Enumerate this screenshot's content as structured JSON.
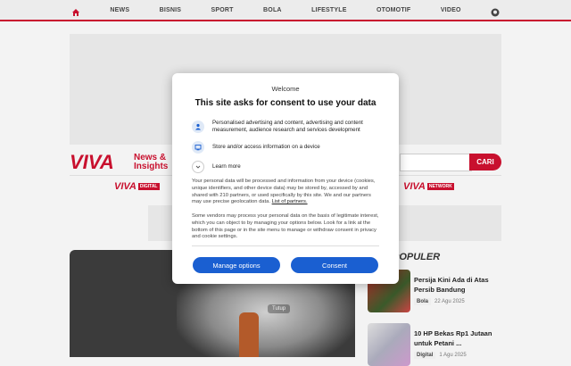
{
  "nav": {
    "items": [
      "NEWS",
      "BISNIS",
      "SPORT",
      "BOLA",
      "LIFESTYLE",
      "OTOMOTIF",
      "VIDEO"
    ]
  },
  "brand": {
    "logo": "VIVA",
    "tagline_1": "News &",
    "tagline_2": "Insights",
    "search_button": "CARI",
    "accent": "#c8102e"
  },
  "sub_brands": [
    {
      "logo": "VIVA",
      "tag": "DIGITAL"
    },
    {
      "logo": "VIVA",
      "tag": "NETWORK"
    }
  ],
  "hero": {
    "close_label": "Tutup"
  },
  "sidebar": {
    "heading": "POPULER",
    "articles": [
      {
        "title": "Persija Kini Ada di Atas Persib Bandung",
        "category": "Bola",
        "date": "22 Agu 2025"
      },
      {
        "title": "10 HP Bekas Rp1 Jutaan untuk Petani ...",
        "category": "Digital",
        "date": "1 Agu 2025"
      }
    ]
  },
  "consent": {
    "welcome": "Welcome",
    "title": "This site asks for consent to use your data",
    "purpose_1": "Personalised advertising and content, advertising and content measurement, audience research and services development",
    "purpose_2": "Store and/or access information on a device",
    "learn_more": "Learn more",
    "para_1": "Your personal data will be processed and information from your device (cookies, unique identifiers, and other device data) may be stored by, accessed by and shared with 210 partners, or used specifically by this site. We and our partners may use precise geolocation data.",
    "partners_link": "List of partners.",
    "para_2": "Some vendors may process your personal data on the basis of legitimate interest, which you can object to by managing your options below. Look for a link at the bottom of this page or in the site menu to manage or withdraw consent in privacy and cookie settings.",
    "manage_button": "Manage options",
    "consent_button": "Consent",
    "button_color": "#1a5fd1"
  }
}
